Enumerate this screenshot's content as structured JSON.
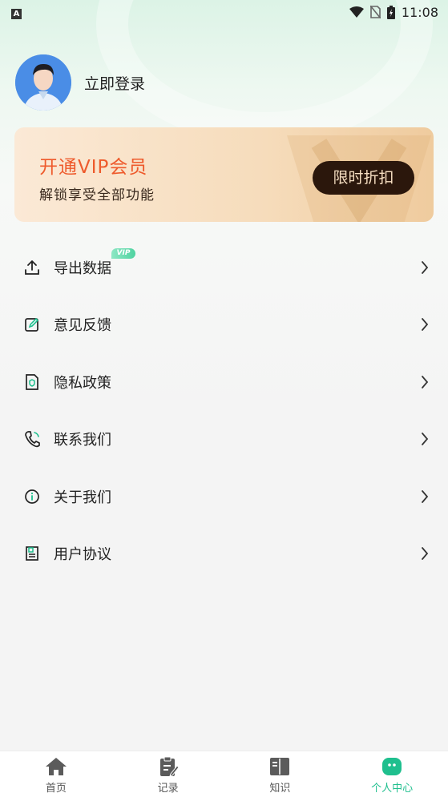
{
  "status_bar": {
    "time": "11:08",
    "indicator": "A"
  },
  "profile": {
    "login_text": "立即登录"
  },
  "vip_card": {
    "title": "开通VIP会员",
    "subtitle": "解锁享受全部功能",
    "button": "限时折扣"
  },
  "menu": {
    "items": [
      {
        "label": "导出数据",
        "icon": "upload-icon",
        "badge": "VIP"
      },
      {
        "label": "意见反馈",
        "icon": "edit-icon"
      },
      {
        "label": "隐私政策",
        "icon": "privacy-doc-icon"
      },
      {
        "label": "联系我们",
        "icon": "phone-icon"
      },
      {
        "label": "关于我们",
        "icon": "info-icon"
      },
      {
        "label": "用户协议",
        "icon": "agreement-icon"
      }
    ]
  },
  "tabbar": {
    "tabs": [
      {
        "label": "首页",
        "icon": "home-icon",
        "active": false
      },
      {
        "label": "记录",
        "icon": "record-icon",
        "active": false
      },
      {
        "label": "知识",
        "icon": "book-icon",
        "active": false
      },
      {
        "label": "个人中心",
        "icon": "profile-center-icon",
        "active": true
      }
    ]
  },
  "colors": {
    "accent": "#1fbf8e",
    "vip_title": "#ee5a2c",
    "vip_button_bg": "#2b170c"
  }
}
